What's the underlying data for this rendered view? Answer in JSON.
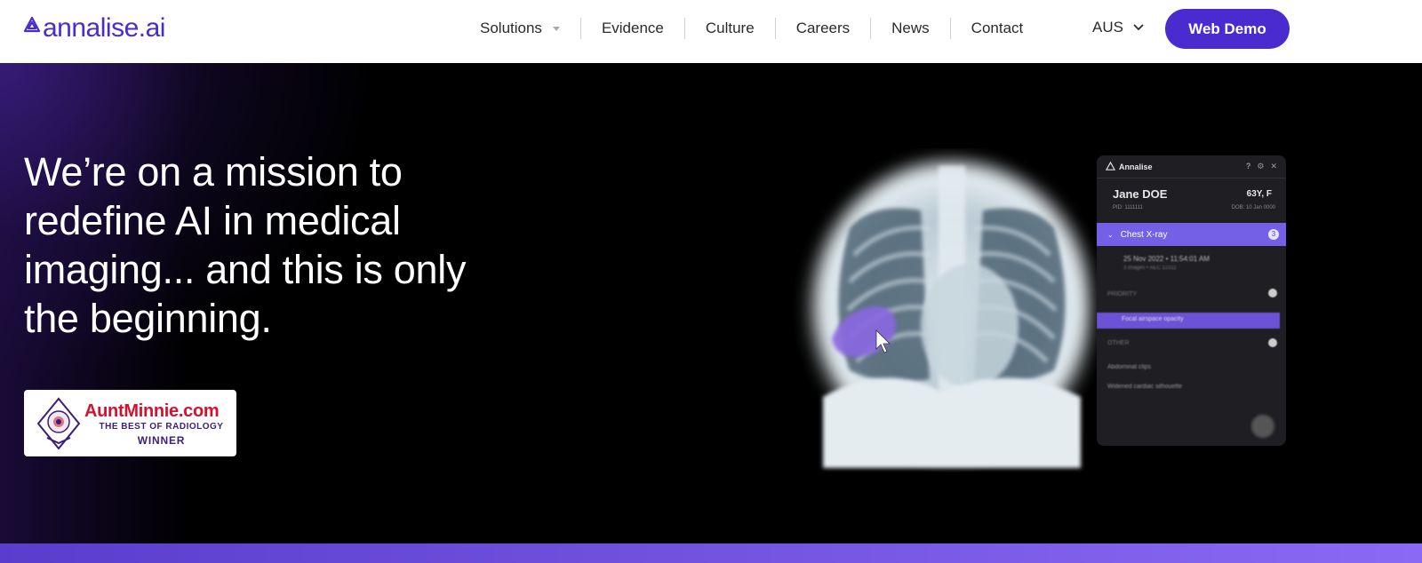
{
  "brand": {
    "logo_text": "annalise.ai",
    "accent": "#4a2bd0"
  },
  "nav": {
    "items": [
      {
        "label": "Solutions",
        "has_dropdown": true
      },
      {
        "label": "Evidence"
      },
      {
        "label": "Culture"
      },
      {
        "label": "Careers"
      },
      {
        "label": "News"
      },
      {
        "label": "Contact"
      }
    ],
    "region": "AUS",
    "cta": "Web Demo"
  },
  "hero": {
    "headline": "We’re on a mission to redefine AI in medical imaging... and this is only the beginning.",
    "award": {
      "title": "AuntMinnie.com",
      "subtitle": "THE BEST OF RADIOLOGY",
      "status": "WINNER"
    }
  },
  "panel": {
    "app_name": "Annalise",
    "patient_name": "Jane DOE",
    "patient_age_sex": "63Y, F",
    "study_label": "Chest X-ray",
    "study_count": "3",
    "study_date": "25 Nov 2022 • 11:54:01 AM"
  },
  "icons": [
    "annalise-logo-icon",
    "chevron-down-icon",
    "award-seal-icon",
    "help-icon",
    "settings-icon",
    "close-icon",
    "cursor-icon"
  ]
}
